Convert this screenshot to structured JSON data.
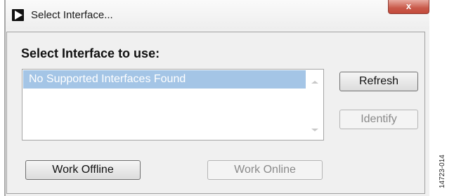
{
  "window": {
    "title": "Select Interface...",
    "close_glyph": "x"
  },
  "main": {
    "heading": "Select Interface to use:",
    "interfaces": [
      "No Supported Interfaces Found"
    ]
  },
  "buttons": {
    "refresh": "Refresh",
    "identify": "Identify",
    "work_offline": "Work Offline",
    "work_online": "Work Online"
  },
  "figure_id": "14723-014",
  "colors": {
    "selection": "#a4c5e6",
    "close_button": "#c9594a",
    "window_bg": "#f0f0f0"
  }
}
